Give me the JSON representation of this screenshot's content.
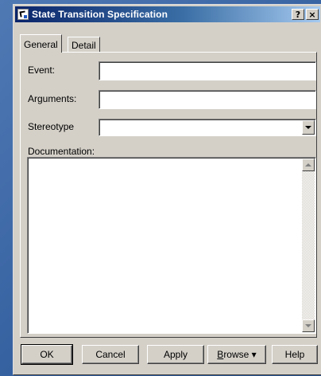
{
  "window": {
    "title": "State Transition Specification",
    "help_label": "?",
    "close_label": "×"
  },
  "tabs": [
    {
      "label": "General",
      "active": true
    },
    {
      "label": "Detail",
      "active": false
    }
  ],
  "form": {
    "event": {
      "label": "Event:",
      "value": ""
    },
    "arguments": {
      "label": "Arguments:",
      "value": ""
    },
    "stereotype": {
      "label": "Stereotype",
      "value": ""
    },
    "documentation": {
      "label": "Documentation:",
      "value": ""
    }
  },
  "buttons": {
    "ok": "OK",
    "cancel": "Cancel",
    "apply": "Apply",
    "browse_first": "B",
    "browse_rest": "rowse",
    "browse_arrow": "▾",
    "help": "Help"
  }
}
